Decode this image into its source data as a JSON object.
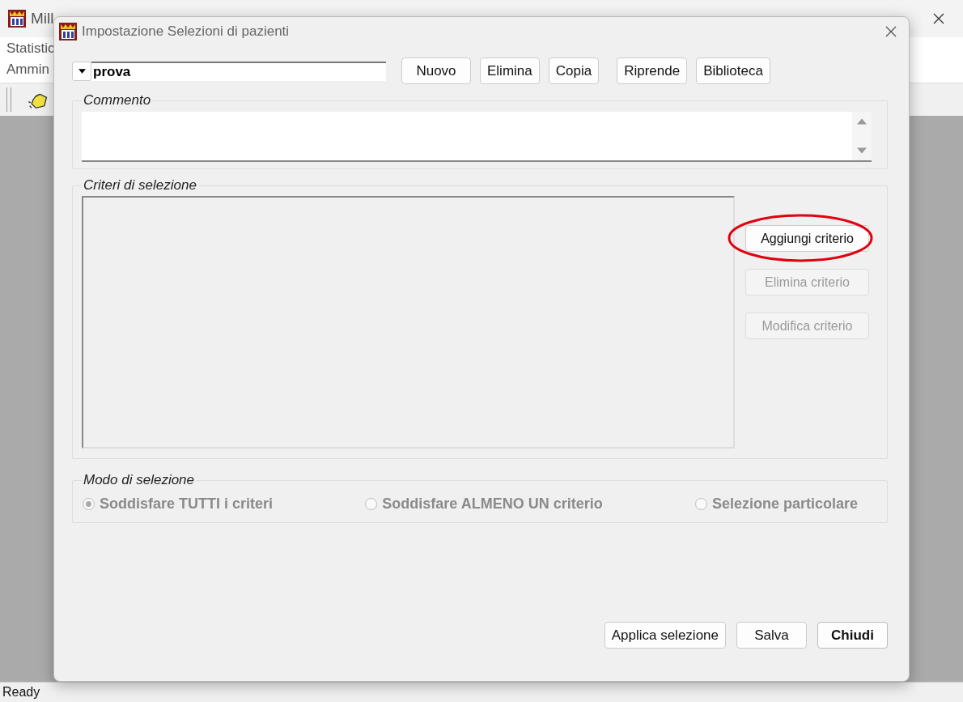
{
  "main_window": {
    "title": "Mill",
    "menu": [
      "Statistic",
      "Ammin"
    ],
    "status_bar": "Ready"
  },
  "dialog": {
    "title": "Impostazione Selezioni di pazienti",
    "selection_name": "prova",
    "toolbar_buttons": [
      {
        "label": "Nuovo"
      },
      {
        "label": "Elimina"
      },
      {
        "label": "Copia"
      },
      {
        "label": "Riprende"
      },
      {
        "label": "Biblioteca"
      }
    ],
    "comment": {
      "label": "Commento"
    },
    "criteria": {
      "label": "Criteri di selezione",
      "buttons": [
        {
          "label": "Aggiungi criterio",
          "disabled": false,
          "highlighted": true
        },
        {
          "label": "Elimina criterio",
          "disabled": true,
          "highlighted": false
        },
        {
          "label": "Modifica criterio",
          "disabled": true,
          "highlighted": false
        }
      ]
    },
    "mode": {
      "label": "Modo di selezione",
      "options": [
        {
          "label": "Soddisfare TUTTI i criteri",
          "selected": true
        },
        {
          "label": "Soddisfare ALMENO UN criterio",
          "selected": false
        },
        {
          "label": "Selezione particolare",
          "selected": false
        }
      ]
    },
    "footer_buttons": [
      {
        "label": "Applica selezione",
        "default": false
      },
      {
        "label": "Salva",
        "default": false
      },
      {
        "label": "Chiudi",
        "default": true
      }
    ]
  }
}
